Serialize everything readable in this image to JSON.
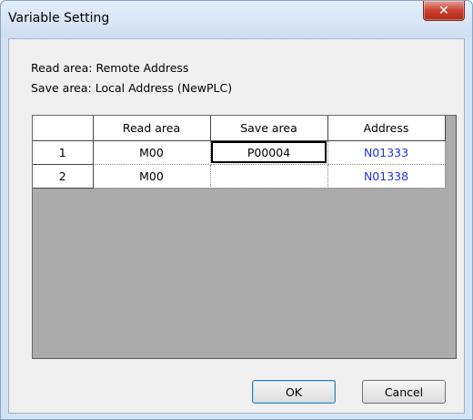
{
  "window": {
    "title": "Variable Setting",
    "close_glyph": "✕"
  },
  "info": {
    "read_area_line": "Read area: Remote Address",
    "save_area_line": "Save area: Local Address (NewPLC)"
  },
  "table": {
    "columns": [
      "",
      "Read area",
      "Save area",
      "Address"
    ],
    "rows": [
      {
        "num": "1",
        "read_area": "M00",
        "save_area": "P00004",
        "address": "N01333"
      },
      {
        "num": "2",
        "read_area": "M00",
        "save_area": "",
        "address": "N01338"
      }
    ]
  },
  "buttons": {
    "ok_label": "OK",
    "cancel_label": "Cancel"
  },
  "colors": {
    "address_text": "#1f33e0",
    "title_bar": "#d4e3f3",
    "close_button": "#c8412e"
  }
}
